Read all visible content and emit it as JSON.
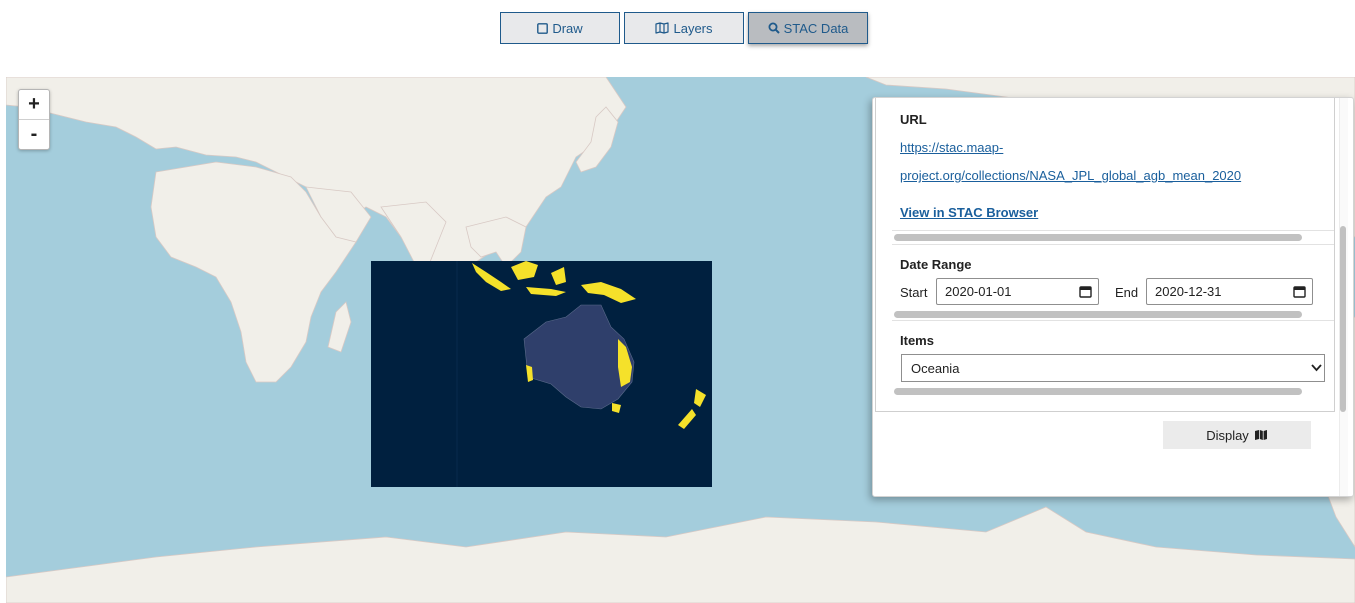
{
  "toolbar": {
    "draw_label": "Draw",
    "layers_label": "Layers",
    "stac_label": "STAC Data"
  },
  "map": {
    "zoom_in": "+",
    "zoom_out": "-",
    "colors": {
      "ocean": "#a4cddc",
      "land": "#f1efe9",
      "raster": "#00203f",
      "highlight": "#f5e12a"
    }
  },
  "panel": {
    "url_heading": "URL",
    "url_line1": "https://stac.maap-",
    "url_line2": "project.org/collections/NASA_JPL_global_agb_mean_2020",
    "browser_link": "View in STAC Browser",
    "date_heading": "Date Range",
    "start_label": "Start",
    "start_value": "2020-01-01",
    "end_label": "End",
    "end_value": "2020-12-31",
    "items_heading": "Items",
    "items_selected": "Oceania",
    "display_label": "Display"
  }
}
